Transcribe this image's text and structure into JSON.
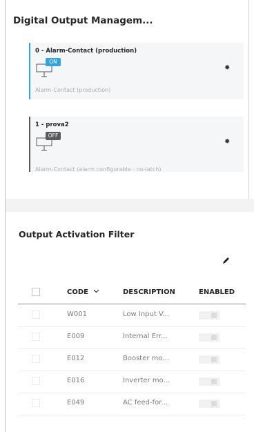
{
  "digital_output": {
    "title": "Digital Output Managem...",
    "outputs": [
      {
        "name": "0 - Alarm-Contact (production)",
        "state": "ON",
        "state_color": "#2fa5e0",
        "description": "Alarm-Contact (production)",
        "icon": "settings-gear-icon"
      },
      {
        "name": "1 - prova2",
        "state": "OFF",
        "state_color": "#5a5a5a",
        "description": "Alarm-Contact (alarm configurable - no-latch)",
        "icon": "settings-gear-icon"
      }
    ]
  },
  "activation_filter": {
    "title": "Output Activation Filter",
    "edit_icon": "pencil-icon",
    "columns": {
      "code": "CODE",
      "description": "DESCRIPTION",
      "enabled": "ENABLED"
    },
    "sort_icon": "chevron-down-icon",
    "rows": [
      {
        "code": "W001",
        "description": "Low Input V...",
        "enabled": false
      },
      {
        "code": "E009",
        "description": "Internal Err...",
        "enabled": false
      },
      {
        "code": "E012",
        "description": "Booster mo...",
        "enabled": false
      },
      {
        "code": "E016",
        "description": "Inverter mo...",
        "enabled": false
      },
      {
        "code": "E049",
        "description": "AC feed-for...",
        "enabled": false
      }
    ]
  }
}
